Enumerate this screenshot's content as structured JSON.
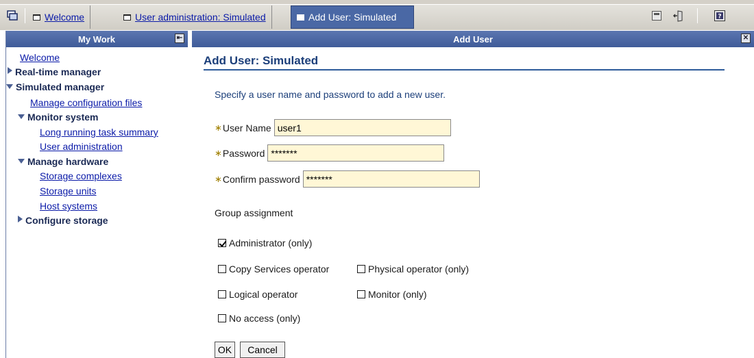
{
  "tabs": [
    {
      "label": "Welcome",
      "type": "link"
    },
    {
      "label": "User administration: Simulated",
      "type": "link"
    },
    {
      "label": "Add User: Simulated",
      "type": "active"
    }
  ],
  "toolbar": {
    "icons": [
      "task-switch-icon",
      "minimize-icon",
      "logout-icon",
      "help-icon"
    ]
  },
  "left_header": {
    "title": "My Work"
  },
  "right_header": {
    "title": "Add User"
  },
  "nav": {
    "welcome": "Welcome",
    "realtime": "Real-time manager",
    "simulated": "Simulated manager",
    "manage_config": "Manage configuration files",
    "monitor_system": "Monitor system",
    "long_running": "Long running task summary",
    "user_admin": "User administration",
    "manage_hw": "Manage hardware",
    "storage_complexes": "Storage complexes",
    "storage_units": "Storage units",
    "host_systems": "Host systems",
    "configure_storage": "Configure storage"
  },
  "main": {
    "title": "Add User: Simulated",
    "intro": "Specify a user name and password to add a new user.",
    "required_marker": "∗",
    "fields": {
      "username": {
        "label": "User Name",
        "value": "user1"
      },
      "password": {
        "label": "Password",
        "value": "*******"
      },
      "confirm": {
        "label": "Confirm password",
        "value": "*******"
      }
    },
    "group_label": "Group assignment",
    "groups": {
      "administrator": {
        "label": "Administrator (only)",
        "checked": true
      },
      "copy_services": {
        "label": "Copy Services operator",
        "checked": false
      },
      "physical": {
        "label": "Physical operator (only)",
        "checked": false
      },
      "logical": {
        "label": "Logical operator",
        "checked": false
      },
      "monitor": {
        "label": "Monitor (only)",
        "checked": false
      },
      "no_access": {
        "label": "No access (only)",
        "checked": false
      }
    },
    "ok_label": "OK",
    "cancel_label": "Cancel"
  },
  "colors": {
    "header_blue": "#4a68a5",
    "title_blue": "#1c3f7a",
    "link_blue": "#0a1aa8",
    "input_bg": "#fff7d6"
  }
}
